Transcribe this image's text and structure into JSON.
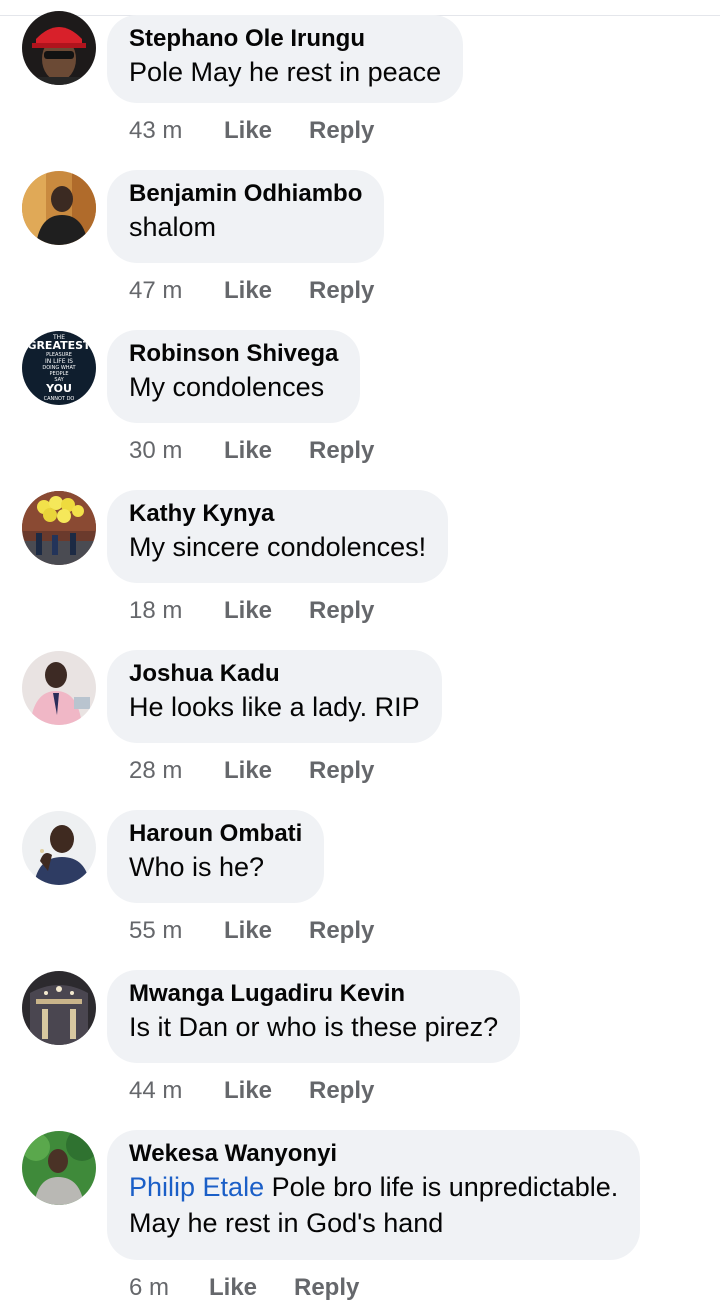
{
  "comments": [
    {
      "author": "Stephano Ole Irungu",
      "text": "Pole May he rest in peace",
      "time": "43 m",
      "like": "Like",
      "reply": "Reply"
    },
    {
      "author": "Benjamin Odhiambo",
      "text": "shalom",
      "time": "47 m",
      "like": "Like",
      "reply": "Reply"
    },
    {
      "author": "Robinson Shivega",
      "text": "My condolences",
      "time": "30 m",
      "like": "Like",
      "reply": "Reply"
    },
    {
      "author": "Kathy Kynya",
      "text": "My sincere condolences!",
      "time": "18 m",
      "like": "Like",
      "reply": "Reply"
    },
    {
      "author": "Joshua Kadu",
      "text": "He looks like a lady. RIP",
      "time": "28 m",
      "like": "Like",
      "reply": "Reply"
    },
    {
      "author": "Haroun Ombati",
      "text": "Who is he?",
      "time": "55 m",
      "like": "Like",
      "reply": "Reply"
    },
    {
      "author": "Mwanga Lugadiru Kevin",
      "text": "Is it Dan or who is these pirez?",
      "time": "44 m",
      "like": "Like",
      "reply": "Reply"
    },
    {
      "author": "Wekesa Wanyonyi",
      "mention": "Philip Etale",
      "text": "Pole bro life is unpredictable.",
      "text_line2": "May he rest in God's hand",
      "time": "6 m",
      "like": "Like",
      "reply": "Reply"
    }
  ],
  "avatar_poster": {
    "line1": "THE",
    "line2": "GREATEST",
    "line3": "PLEASURE",
    "line4": "IN LIFE IS",
    "line5": "DOING WHAT",
    "line6": "PEOPLE",
    "line7": "SAY",
    "line8": "YOU",
    "line9": "CANNOT DO"
  },
  "colors": {
    "bubble": "#f0f2f5",
    "meta": "#65676b",
    "mention": "#1b5fc7"
  }
}
